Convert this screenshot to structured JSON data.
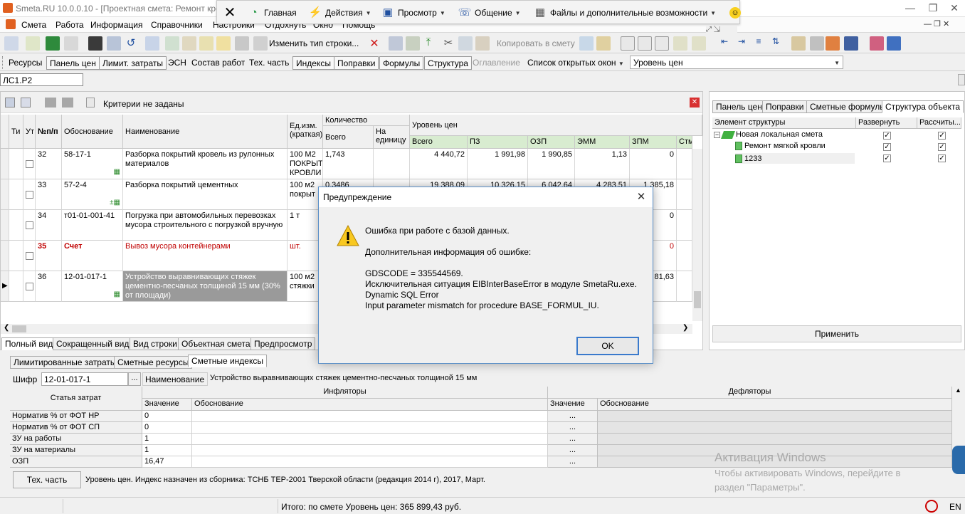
{
  "window": {
    "title": "Smeta.RU  10.0.0.10  - [Проектная смета: Ремонт кро"
  },
  "ribbon": {
    "items": [
      "Главная",
      "Действия",
      "Просмотр",
      "Общение",
      "Файлы и дополнительные возможности"
    ]
  },
  "menu": {
    "items": [
      "Смета",
      "Работа",
      "Информация",
      "Справочники",
      "Настройки",
      "Отдохнуть",
      "Окно",
      "Помощь"
    ]
  },
  "toolbar1": {
    "change_row_type": "Изменить тип строки...",
    "copy_to_estimate": "Копировать в смету"
  },
  "toolbar2": {
    "items": [
      "Ресурсы",
      "Панель цен",
      "Лимит. затраты",
      "ЭСН",
      "Состав работ",
      "Тех. часть",
      "Индексы",
      "Поправки",
      "Формулы",
      "Структура",
      "Оглавление",
      "Список открытых окон"
    ],
    "price_level_combo": "Уровень цен"
  },
  "doc_field": "ЛС1.Р2",
  "filter": {
    "criteria": "Критерии не заданы"
  },
  "grid": {
    "headers": {
      "ti": "Ти",
      "ut": "Ут",
      "npp": "№п/п",
      "basis": "Обоснование",
      "name": "Наименование",
      "unit": "Ед.изм. (краткая)",
      "quantity": "Количество",
      "q_total": "Всего",
      "q_per_unit": "На единицу",
      "price_level": "Уровень цен",
      "p_total": "Всего",
      "pz": "ПЗ",
      "ozp": "ОЗП",
      "emm": "ЭММ",
      "zpm": "ЗПМ",
      "stm": "Стм"
    },
    "rows": [
      {
        "n": "32",
        "basis": "58-17-1",
        "name": "Разборка покрытий кровель из рулонных материалов",
        "unit": "100 М2 ПОКРЫТ КРОВЛИ",
        "q_total": "1,743",
        "q_unit": "",
        "total": "4 440,72",
        "pz": "1 991,98",
        "ozp": "1 990,85",
        "emm": "1,13",
        "zpm": "0"
      },
      {
        "n": "33",
        "basis": "57-2-4",
        "name": "Разборка покрытий  цементных",
        "unit": "100 м2 покрыт",
        "q_total": "0,3486",
        "q_unit": "",
        "total": "19 388,09",
        "pz": "10 326,15",
        "ozp": "6 042,64",
        "emm": "4 283,51",
        "zpm": "1 385,18"
      },
      {
        "n": "34",
        "basis": "т01-01-001-41",
        "name": "Погрузка при автомобильных перевозках мусора строительного с погрузкой вручную",
        "unit": "1 т",
        "q_total": "",
        "q_unit": "",
        "total": "",
        "pz": "",
        "ozp": "",
        "emm": "",
        "zpm": "0"
      },
      {
        "n": "35",
        "basis": "Счет",
        "name": "Вывоз мусора контейнерами",
        "unit": "шт.",
        "q_total": "",
        "q_unit": "",
        "total": "",
        "pz": "",
        "ozp": "",
        "emm": "",
        "zpm": "0"
      },
      {
        "n": "36",
        "basis": "12-01-017-1",
        "name": "Устройство выравнивающих стяжек цементно-песчаных толщиной 15 мм (30% от площади)",
        "unit": "100 м2 стяжки",
        "q_total": "",
        "q_unit": "",
        "total": "",
        "pz": "",
        "ozp": "",
        "emm": "",
        "zpm": "81,63"
      }
    ]
  },
  "view_tabs": [
    "Полный вид",
    "Сокращенный вид",
    "Вид строки",
    "Объектная смета",
    "Предпросмотр"
  ],
  "right_panel": {
    "tabs": [
      "Панель цен",
      "Поправки",
      "Сметные формулы",
      "Структура объекта"
    ],
    "headers": [
      "Элемент структуры",
      "Развернуть",
      "Рассчиты..."
    ],
    "tree": [
      "Новая локальная смета",
      "Ремонт мягкой кровли",
      "1233"
    ],
    "apply_button": "Применить"
  },
  "lower": {
    "tabs": [
      "Лимитированные затраты",
      "Сметные ресурсы",
      "Сметные индексы"
    ],
    "code_label": "Шифр",
    "code_value": "12-01-017-1",
    "code_button": "...",
    "name_label": "Наименование",
    "name_value": "Устройство выравнивающих стяжек цементно-песчаных толщиной 15 мм",
    "headers": {
      "cost_item": "Статья затрат",
      "inflators": "Инфляторы",
      "deflators": "Дефляторы",
      "value": "Значение",
      "basis": "Обоснование"
    },
    "rows": [
      {
        "item": "Норматив % от ФОТ НР",
        "value": "0",
        "dvalue": "..."
      },
      {
        "item": "Норматив % от ФОТ СП",
        "value": "0",
        "dvalue": "..."
      },
      {
        "item": "ЗУ на работы",
        "value": "1",
        "dvalue": "..."
      },
      {
        "item": "ЗУ на материалы",
        "value": "1",
        "dvalue": "..."
      },
      {
        "item": "ОЗП",
        "value": "16,47",
        "dvalue": "..."
      }
    ],
    "tech_part_button": "Тех. часть",
    "info_text": "Уровень цен. Индекс назначен из сборника: ТСНБ ТЕР-2001 Тверской области (редакция 2014 г), 2017, Март."
  },
  "status": {
    "total": "Итого: по смете Уровень цен: 365 899,43 руб.",
    "lang": "EN"
  },
  "dialog": {
    "title": "Предупреждение",
    "line1": "Ошибка при работе с базой данных.",
    "line2": "Дополнительная информация об ошибке:",
    "line3": "GDSCODE = 335544569.",
    "line4": "Исключительная ситуация EIBInterBaseError в модуле SmetaRu.exe.",
    "line5": "Dynamic SQL Error",
    "line6": "Input parameter mismatch for procedure BASE_FORMUL_IU.",
    "ok_button": "OK"
  },
  "watermark": {
    "line1": "Активация Windows",
    "line2": "Чтобы активировать Windows, перейдите в",
    "line3": "раздел \"Параметры\"."
  },
  "colors": {
    "dialog_border": "#5a8fc8",
    "highlight_red": "#c00000",
    "selected_cell": "#9a9a9a",
    "header_green": "#d8ecd0"
  }
}
